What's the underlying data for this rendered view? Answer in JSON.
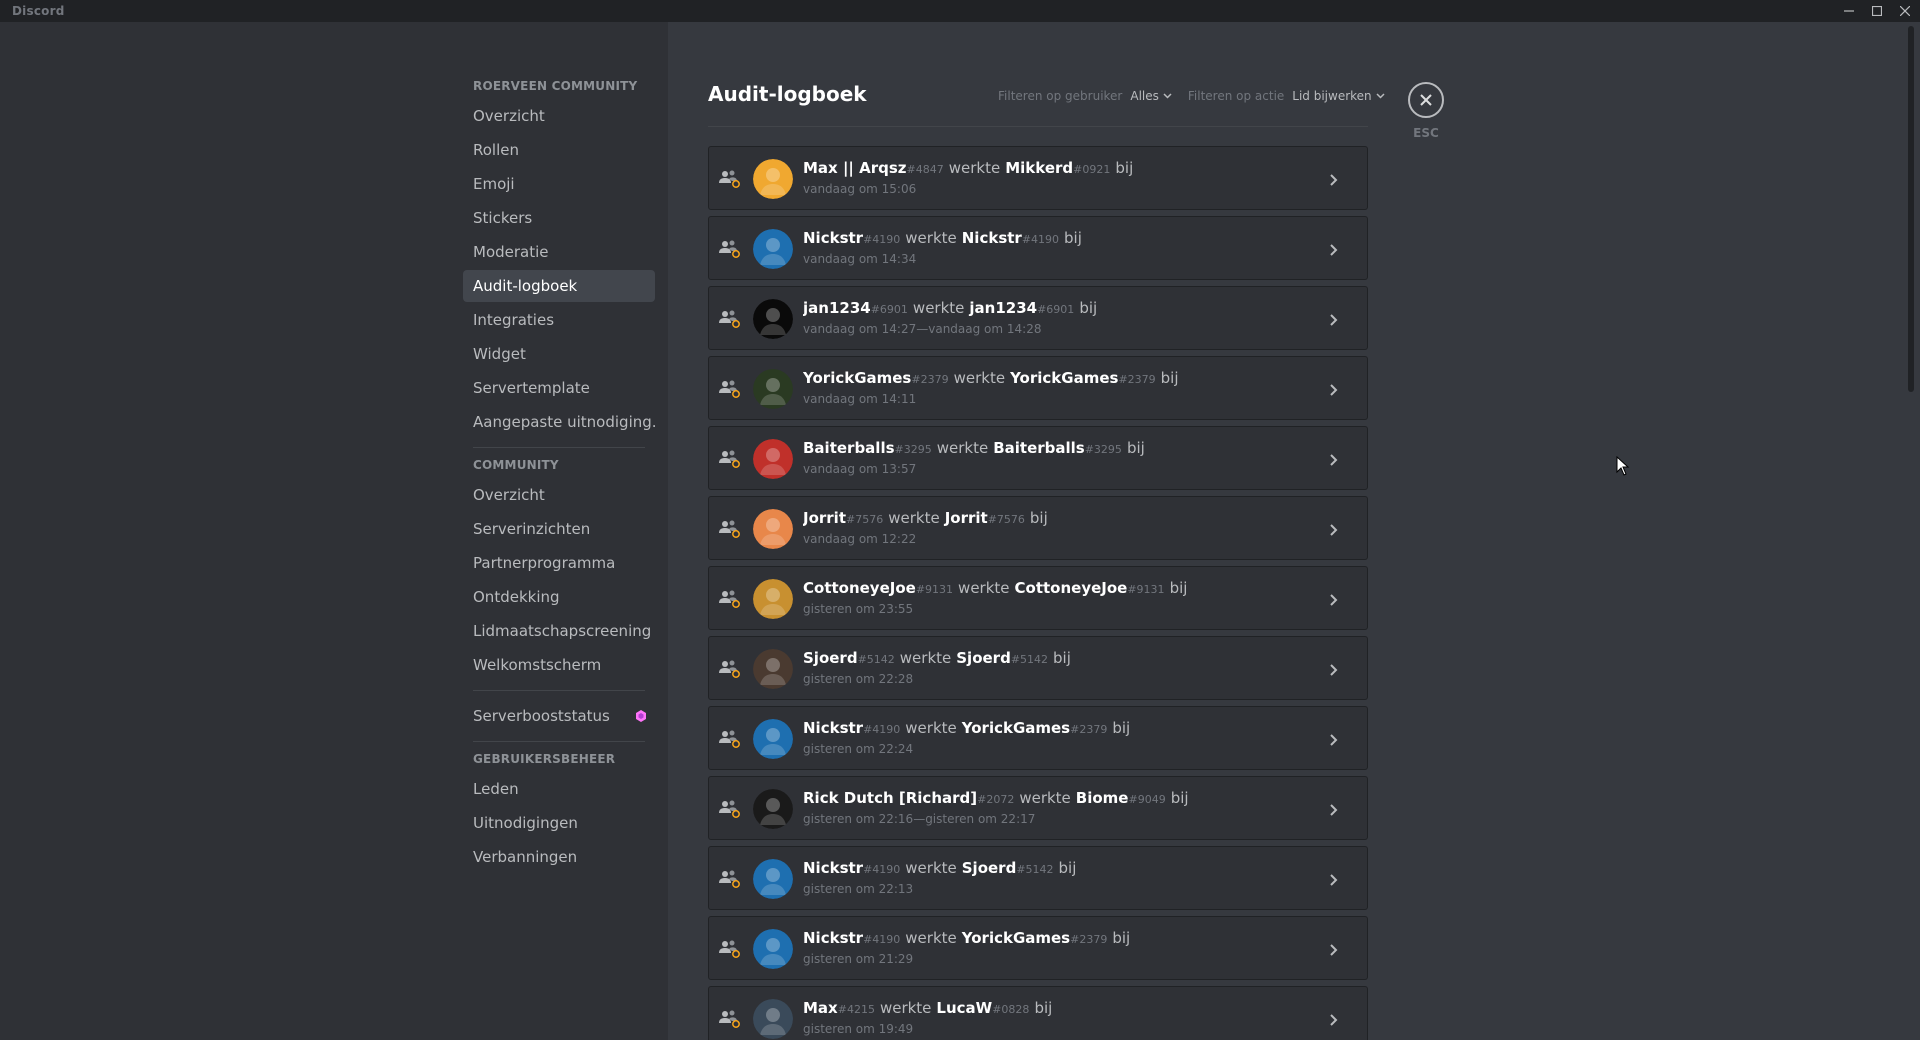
{
  "window": {
    "app_name": "Discord",
    "controls": [
      "minimize-icon",
      "maximize-icon",
      "close-icon"
    ]
  },
  "sidebar": {
    "sections": [
      {
        "header": "Roerveen Community",
        "items": [
          {
            "label": "Overzicht",
            "name": "overzicht"
          },
          {
            "label": "Rollen",
            "name": "rollen"
          },
          {
            "label": "Emoji",
            "name": "emoji"
          },
          {
            "label": "Stickers",
            "name": "stickers"
          },
          {
            "label": "Moderatie",
            "name": "moderatie"
          },
          {
            "label": "Audit-logboek",
            "name": "audit-logboek",
            "active": true
          },
          {
            "label": "Integraties",
            "name": "integraties"
          },
          {
            "label": "Widget",
            "name": "widget"
          },
          {
            "label": "Servertemplate",
            "name": "servertemplate"
          },
          {
            "label": "Aangepaste uitnodiging...",
            "name": "aangepaste-uitnodiging"
          }
        ]
      },
      {
        "header": "Community",
        "items": [
          {
            "label": "Overzicht",
            "name": "community-overzicht"
          },
          {
            "label": "Serverinzichten",
            "name": "serverinzichten"
          },
          {
            "label": "Partnerprogramma",
            "name": "partnerprogramma"
          },
          {
            "label": "Ontdekking",
            "name": "ontdekking"
          },
          {
            "label": "Lidmaatschapscreening",
            "name": "lidmaatschapscreening"
          },
          {
            "label": "Welkomstscherm",
            "name": "welkomstscherm"
          }
        ]
      },
      {
        "header": "",
        "items": [
          {
            "label": "Serverbooststatus",
            "name": "serverbooststatus",
            "icon": "boost-gem-icon"
          }
        ]
      },
      {
        "header": "Gebruikersbeheer",
        "items": [
          {
            "label": "Leden",
            "name": "leden"
          },
          {
            "label": "Uitnodigingen",
            "name": "uitnodigingen"
          },
          {
            "label": "Verbanningen",
            "name": "verbanningen"
          }
        ]
      }
    ]
  },
  "main": {
    "title": "Audit-logboek",
    "filters": {
      "user_label": "Filteren op gebruiker",
      "user_value": "Alles",
      "action_label": "Filteren op actie",
      "action_value": "Lid bijwerken"
    },
    "close_label": "ESC",
    "verb": "werkte",
    "suffix": "bij",
    "log_entries": [
      {
        "actor": "Max || Arqsz",
        "actor_disc": "#4847",
        "target": "Mikkerd",
        "target_disc": "#0921",
        "time": "vandaag om 15:06",
        "avatar": "#f0a830"
      },
      {
        "actor": "Nickstr",
        "actor_disc": "#4190",
        "target": "Nickstr",
        "target_disc": "#4190",
        "time": "vandaag om 14:34",
        "avatar": "#1e6fb0"
      },
      {
        "actor": "jan1234",
        "actor_disc": "#6901",
        "target": "jan1234",
        "target_disc": "#6901",
        "time": "vandaag om 14:27—vandaag om 14:28",
        "avatar": "#0a0a0a"
      },
      {
        "actor": "YorickGames",
        "actor_disc": "#2379",
        "target": "YorickGames",
        "target_disc": "#2379",
        "time": "vandaag om 14:11",
        "avatar": "#2a3a22"
      },
      {
        "actor": "Baiterballs",
        "actor_disc": "#3295",
        "target": "Baiterballs",
        "target_disc": "#3295",
        "time": "vandaag om 13:57",
        "avatar": "#c0302a"
      },
      {
        "actor": "Jorrit",
        "actor_disc": "#7576",
        "target": "Jorrit",
        "target_disc": "#7576",
        "time": "vandaag om 12:22",
        "avatar": "#e8874a"
      },
      {
        "actor": "CottoneyeJoe",
        "actor_disc": "#9131",
        "target": "CottoneyeJoe",
        "target_disc": "#9131",
        "time": "gisteren om 23:55",
        "avatar": "#c89030"
      },
      {
        "actor": "Sjoerd",
        "actor_disc": "#5142",
        "target": "Sjoerd",
        "target_disc": "#5142",
        "time": "gisteren om 22:28",
        "avatar": "#4a3a30"
      },
      {
        "actor": "Nickstr",
        "actor_disc": "#4190",
        "target": "YorickGames",
        "target_disc": "#2379",
        "time": "gisteren om 22:24",
        "avatar": "#1e6fb0"
      },
      {
        "actor": "Rick Dutch [Richard]",
        "actor_disc": "#2072",
        "target": "Biome",
        "target_disc": "#9049",
        "time": "gisteren om 22:16—gisteren om 22:17",
        "avatar": "#1a1a1a"
      },
      {
        "actor": "Nickstr",
        "actor_disc": "#4190",
        "target": "Sjoerd",
        "target_disc": "#5142",
        "time": "gisteren om 22:13",
        "avatar": "#1e6fb0"
      },
      {
        "actor": "Nickstr",
        "actor_disc": "#4190",
        "target": "YorickGames",
        "target_disc": "#2379",
        "time": "gisteren om 21:29",
        "avatar": "#1e6fb0"
      },
      {
        "actor": "Max",
        "actor_disc": "#4215",
        "target": "LucaW",
        "target_disc": "#0828",
        "time": "gisteren om 19:49",
        "avatar": "#3a4a5a"
      }
    ]
  },
  "colors": {
    "background": "#36393f",
    "sidebar": "#2f3136",
    "titlebar": "#202225",
    "boost_pink": "#ff73fa"
  }
}
